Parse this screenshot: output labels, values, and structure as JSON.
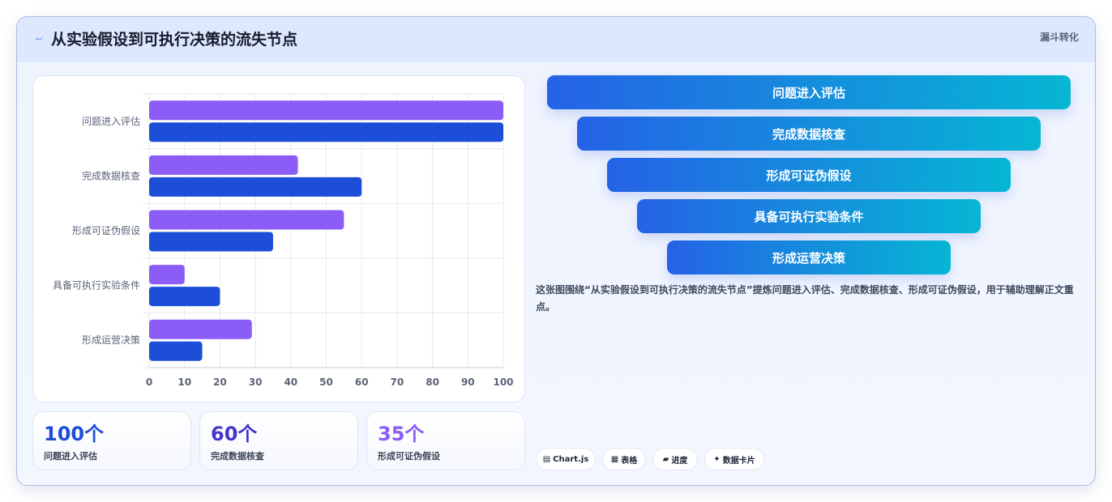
{
  "header": {
    "title": "从实验假设到可执行决策的流失节点",
    "tag": "漏斗转化",
    "icon": "lightning-icon"
  },
  "colors": {
    "series_a": "#8b5cf6",
    "series_b": "#1d4ed8",
    "funnel_start": "#2562e6",
    "funnel_end": "#06b6d4"
  },
  "chart_data": {
    "type": "bar",
    "orientation": "horizontal",
    "categories": [
      "问题进入评估",
      "完成数据核查",
      "形成可证伪假设",
      "具备可执行实验条件",
      "形成运营决策"
    ],
    "series": [
      {
        "values": [
          100,
          42,
          55,
          10,
          29
        ]
      },
      {
        "values": [
          100,
          60,
          35,
          20,
          15
        ]
      }
    ],
    "xlim": [
      0,
      100
    ],
    "x_ticks": [
      0,
      10,
      20,
      30,
      40,
      50,
      60,
      70,
      80,
      90,
      100
    ],
    "grid": true,
    "legend": "none"
  },
  "stats": [
    {
      "value": "100个",
      "label": "问题进入评估",
      "color": "#1d4ed8"
    },
    {
      "value": "60个",
      "label": "完成数据核查",
      "color": "#4338ca"
    },
    {
      "value": "35个",
      "label": "形成可证伪假设",
      "color": "#8b5cf6"
    }
  ],
  "funnel": [
    "问题进入评估",
    "完成数据核查",
    "形成可证伪假设",
    "具备可执行实验条件",
    "形成运营决策"
  ],
  "description": "这张图围绕“从实验假设到可执行决策的流失节点”提炼问题进入评估、完成数据核查、形成可证伪假设，用于辅助理解正文重点。",
  "chips": [
    {
      "icon": "chart-icon",
      "glyph": "▤",
      "label": "Chart.js"
    },
    {
      "icon": "table-icon",
      "glyph": "▦",
      "label": "表格"
    },
    {
      "icon": "progress-icon",
      "glyph": "▰",
      "label": "进度"
    },
    {
      "icon": "card-icon",
      "glyph": "✦",
      "label": "数据卡片"
    }
  ]
}
